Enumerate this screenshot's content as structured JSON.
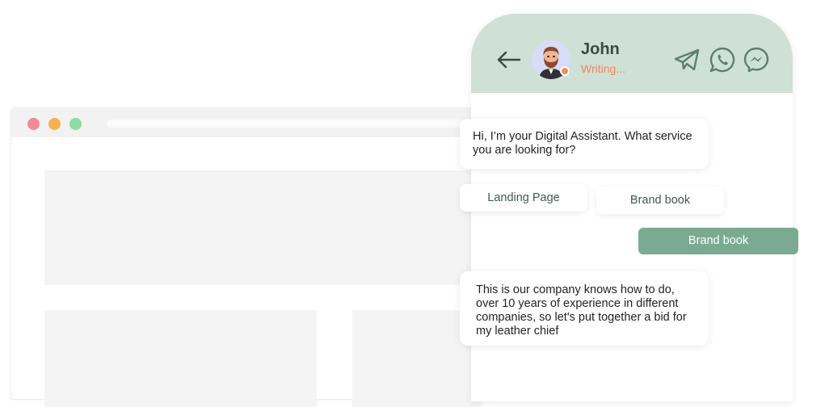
{
  "browser": {
    "dots": [
      "red",
      "yellow",
      "green"
    ],
    "colors": {
      "red": "#f18a96",
      "yellow": "#f5b152",
      "green": "#8ddba2"
    }
  },
  "chat": {
    "header": {
      "back_icon": "arrow-left-icon",
      "contact_name": "John",
      "contact_status": "Writing...",
      "icons": [
        "telegram-icon",
        "whatsapp-icon",
        "messenger-icon"
      ],
      "background": "#cfe0d6"
    },
    "messages": [
      {
        "from": "bot",
        "text": "Hi, I’m your Digital Assistant. What service you are looking for?"
      },
      {
        "from": "bot",
        "text": "This is our company knows how to do, over 10 years of experience in different companies, so let's put together a bid for my leather chief"
      }
    ],
    "options": [
      "Landing Page",
      "Brand book"
    ],
    "user_reply": "Brand book",
    "accent": "#7aab92",
    "status_color": "#f0875a"
  }
}
